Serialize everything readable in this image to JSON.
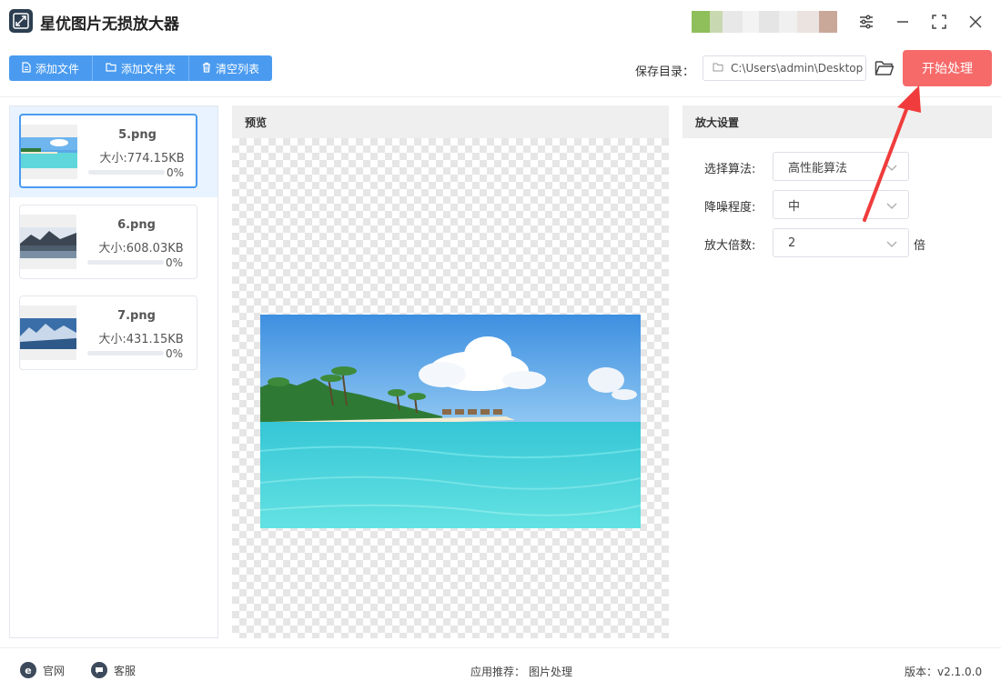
{
  "app": {
    "title": "星优图片无损放大器",
    "icon": "app-logo-icon"
  },
  "window_controls": [
    "settings-sliders-icon",
    "minimize-icon",
    "maximize-icon",
    "close-icon"
  ],
  "toolbar": {
    "add_file": "添加文件",
    "add_folder": "添加文件夹",
    "clear_list": "清空列表",
    "save_dir_label": "保存目录：",
    "save_dir_value": "C:\\Users\\admin\\Desktop",
    "start_label": "开始处理"
  },
  "files": [
    {
      "name": "5.png",
      "size": "大小:774.15KB",
      "percent": "0%",
      "progress": 0,
      "selected": true
    },
    {
      "name": "6.png",
      "size": "大小:608.03KB",
      "percent": "0%",
      "progress": 0,
      "selected": false
    },
    {
      "name": "7.png",
      "size": "大小:431.15KB",
      "percent": "0%",
      "progress": 0,
      "selected": false
    }
  ],
  "preview": {
    "title": "预览"
  },
  "settings": {
    "title": "放大设置",
    "algorithm_label": "选择算法:",
    "algorithm_value": "高性能算法",
    "denoise_label": "降噪程度:",
    "denoise_value": "中",
    "scale_label": "放大倍数:",
    "scale_value": "2",
    "scale_unit": "倍"
  },
  "statusbar": {
    "website": "官网",
    "support": "客服",
    "recommend_label": "应用推荐：",
    "recommend_value": "图片处理",
    "version": "版本：v2.1.0.0"
  },
  "colors": {
    "primary": "#4a9bf0",
    "start_button": "#f66a6a",
    "annotation_arrow": "#f03c3c"
  }
}
